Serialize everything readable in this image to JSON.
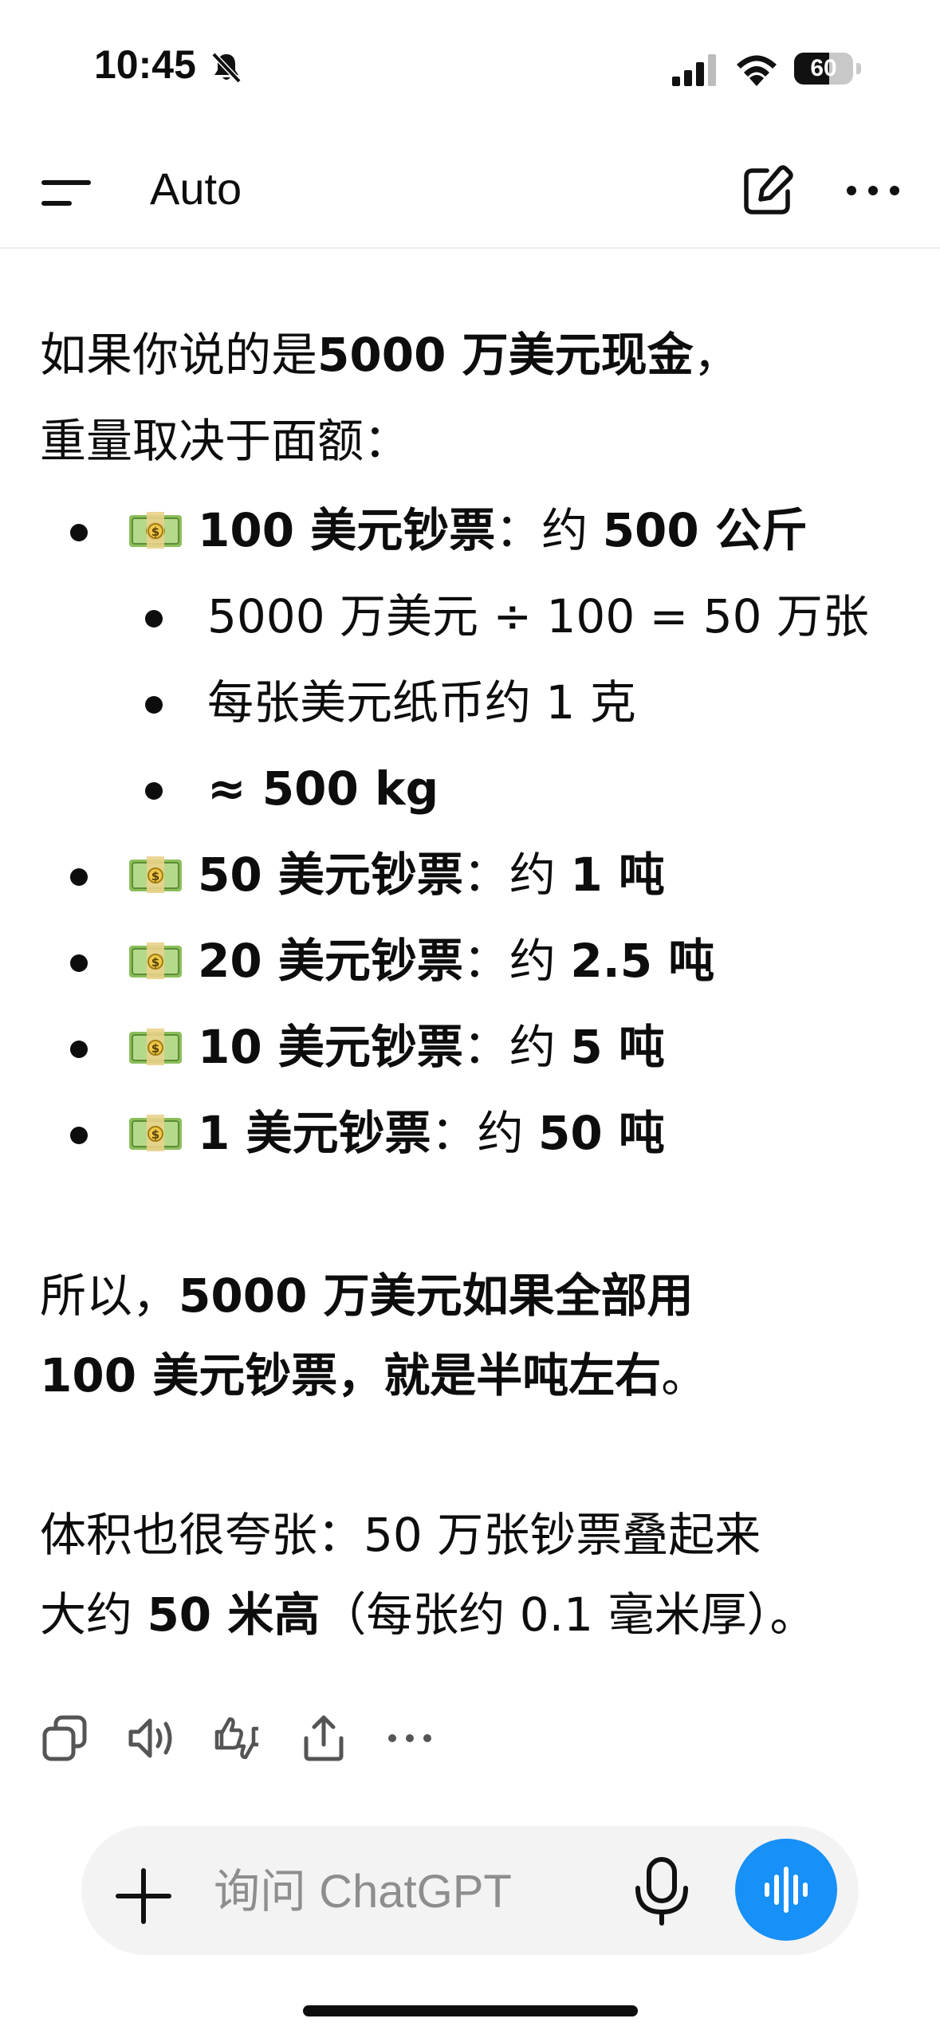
{
  "status_bar": {
    "time": "10:45",
    "battery": "60",
    "battery_level": 0.6
  },
  "header": {
    "title": "Auto"
  },
  "message": {
    "intro_line1_prefix": "如果你说的是",
    "intro_line1_bold": "5000 万美元现金",
    "intro_line1_suffix": "，",
    "intro_line2": "重量取决于面额：",
    "items": [
      {
        "bold": "100 美元钞票",
        "sep": "：约 ",
        "value": "500 公斤"
      },
      {
        "bold": "50 美元钞票",
        "sep": "：约 ",
        "value": "1 吨"
      },
      {
        "bold": "20 美元钞票",
        "sep": "：约 ",
        "value": "2.5 吨"
      },
      {
        "bold": "10 美元钞票",
        "sep": "：约 ",
        "value": "5 吨"
      },
      {
        "bold": "1 美元钞票",
        "sep": "：约 ",
        "value": "50 吨"
      }
    ],
    "subitems": [
      "5000 万美元 ÷ 100 = 50 万张",
      "每张美元纸币约 1 克",
      "≈ 500 kg"
    ],
    "summary_prefix": "所以，",
    "summary_bold_line1": "5000 万美元如果全部用",
    "summary_bold_line2": "100 美元钞票，就是半吨左右",
    "summary_suffix": "。",
    "volume_line1": "体积也很夸张：50 万张钞票叠起来",
    "volume_line2_prefix": "大约 ",
    "volume_line2_bold": "50 米高",
    "volume_line2_suffix": "（每张约 0.1 毫米厚）。"
  },
  "actions": {
    "icons": [
      "copy-icon",
      "speaker-icon",
      "thumbs-feedback-icon",
      "share-icon",
      "more-icon"
    ]
  },
  "composer": {
    "placeholder": "询问 ChatGPT"
  },
  "icons": {
    "money": "money-bag-icon",
    "accent_color": "#1790f7"
  }
}
